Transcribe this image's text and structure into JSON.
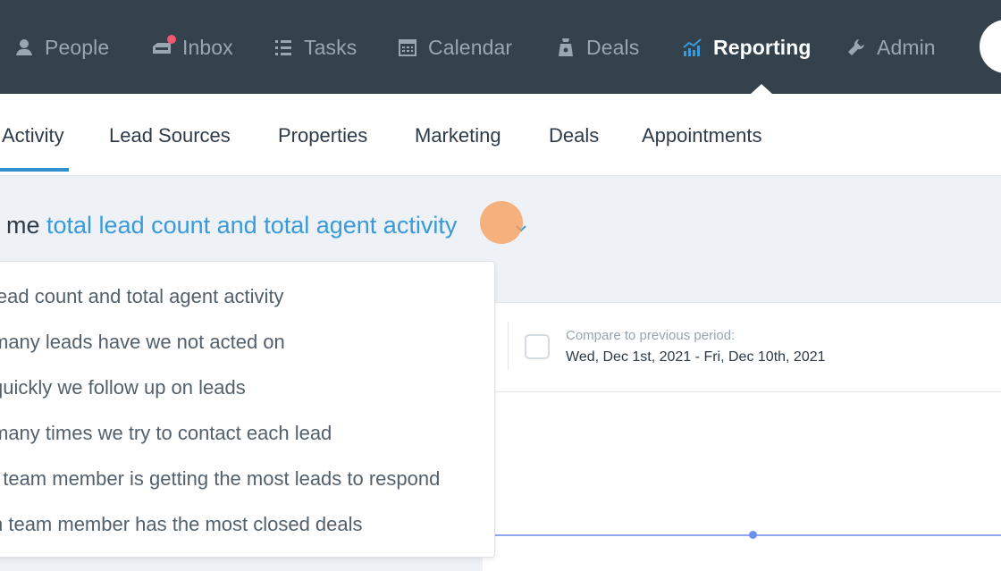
{
  "nav": {
    "items": [
      {
        "label": "People",
        "icon": "people-icon"
      },
      {
        "label": "Inbox",
        "icon": "inbox-icon"
      },
      {
        "label": "Tasks",
        "icon": "tasks-icon"
      },
      {
        "label": "Calendar",
        "icon": "calendar-icon"
      },
      {
        "label": "Deals",
        "icon": "deals-icon"
      },
      {
        "label": "Reporting",
        "icon": "reporting-icon",
        "active": true
      },
      {
        "label": "Admin",
        "icon": "admin-icon"
      }
    ]
  },
  "subtabs": [
    {
      "label": "Activity",
      "active": true
    },
    {
      "label": "Lead Sources"
    },
    {
      "label": "Properties"
    },
    {
      "label": "Marketing"
    },
    {
      "label": "Deals"
    },
    {
      "label": "Appointments"
    }
  ],
  "report": {
    "prefix": "y me ",
    "selected": "total lead count and total agent activity"
  },
  "dropdown": {
    "options": [
      "lead count and total agent activity",
      "many leads have we not acted on",
      "quickly we follow up on leads",
      "many times we try to contact each lead",
      "t team member is getting the most leads to respond",
      "h team member has the most closed deals"
    ]
  },
  "compare": {
    "label": "Compare to previous period:",
    "range": "Wed, Dec 1st, 2021 - Fri, Dec 10th, 2021"
  },
  "colors": {
    "nav_bg": "#34424e",
    "accent": "#3a9ad9",
    "inbox_badge": "#ef5a6f"
  }
}
